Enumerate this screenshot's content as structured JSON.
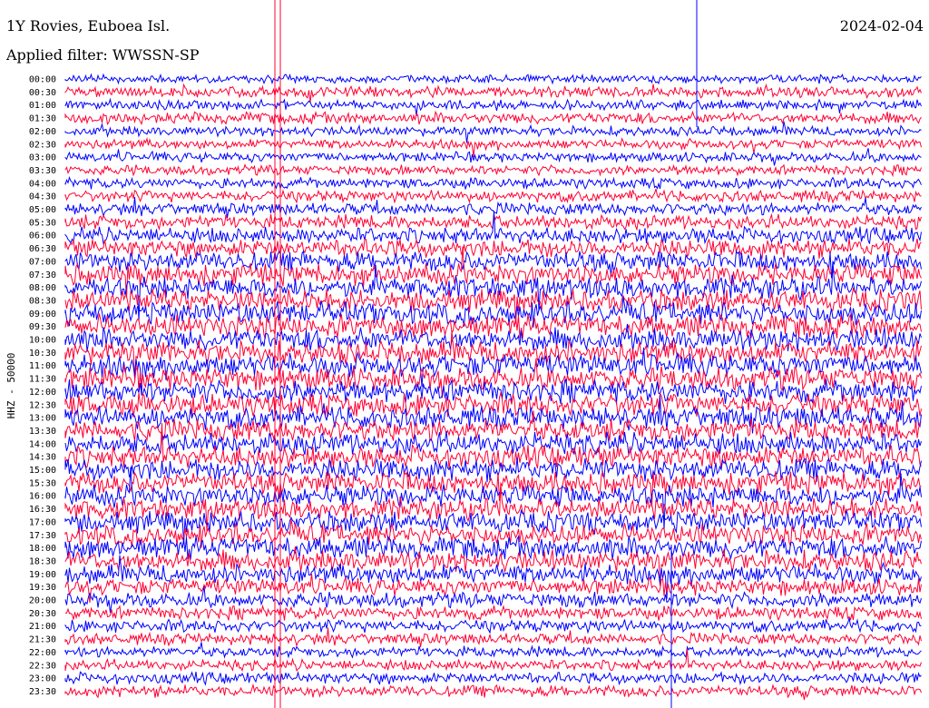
{
  "header": {
    "title": "1Y Rovies, Euboea Isl.",
    "filter": "Applied filter: WWSSN-SP",
    "date": "2024-02-04"
  },
  "chart_data": {
    "type": "line",
    "title": "1Y Rovies, Euboea Isl.",
    "subtitle": "Applied filter: WWSSN-SP",
    "date": "2024-02-04",
    "ylabel": "HHZ - 50000",
    "rows": [
      "00:00",
      "00:30",
      "01:00",
      "01:30",
      "02:00",
      "02:30",
      "03:00",
      "03:30",
      "04:00",
      "04:30",
      "05:00",
      "05:30",
      "06:00",
      "06:30",
      "07:00",
      "07:30",
      "08:00",
      "08:30",
      "09:00",
      "09:30",
      "10:00",
      "10:30",
      "11:00",
      "11:30",
      "12:00",
      "12:30",
      "13:00",
      "13:30",
      "14:00",
      "14:30",
      "15:00",
      "15:30",
      "16:00",
      "16:30",
      "17:00",
      "17:30",
      "18:00",
      "18:30",
      "19:00",
      "19:30",
      "20:00",
      "20:30",
      "21:00",
      "21:30",
      "22:00",
      "22:30",
      "23:00",
      "23:30"
    ],
    "row_minutes": 30,
    "series_colors": [
      "#0000ff",
      "#ff0033"
    ],
    "noise_level": [
      0.15,
      0.3,
      0.25,
      0.35,
      0.25,
      0.25,
      0.25,
      0.25,
      0.3,
      0.35,
      0.4,
      0.5,
      0.6,
      0.75,
      0.85,
      0.9,
      0.95,
      0.95,
      1.0,
      1.0,
      1.0,
      1.0,
      1.0,
      1.0,
      1.0,
      1.0,
      1.0,
      0.95,
      0.95,
      0.95,
      0.95,
      0.95,
      0.95,
      0.9,
      0.9,
      0.9,
      0.95,
      0.9,
      0.8,
      0.65,
      0.55,
      0.45,
      0.4,
      0.35,
      0.3,
      0.3,
      0.35,
      0.35
    ],
    "grid": false
  }
}
